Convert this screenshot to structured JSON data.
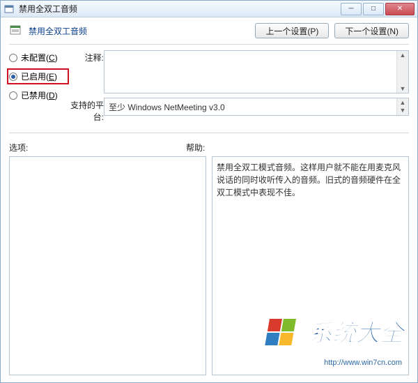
{
  "titlebar": {
    "title": "禁用全双工音频"
  },
  "header": {
    "title": "禁用全双工音频",
    "prev_btn": "上一个设置(P)",
    "next_btn": "下一个设置(N)"
  },
  "radios": {
    "unconfigured": "未配置(C)",
    "enabled": "已启用(E)",
    "disabled": "已禁用(D)"
  },
  "fields": {
    "comment_label": "注释:",
    "comment_value": "",
    "platform_label": "支持的平台:",
    "platform_value": "至少 Windows NetMeeting v3.0"
  },
  "columns": {
    "options": "选项:",
    "help": "帮助:"
  },
  "help_text": "禁用全双工模式音频。这样用户就不能在用麦克风说话的同时收听传入的音频。旧式的音频硬件在全双工模式中表现不佳。",
  "watermark": {
    "brand": "系统大全",
    "url": "http://www.win7cn.com"
  }
}
